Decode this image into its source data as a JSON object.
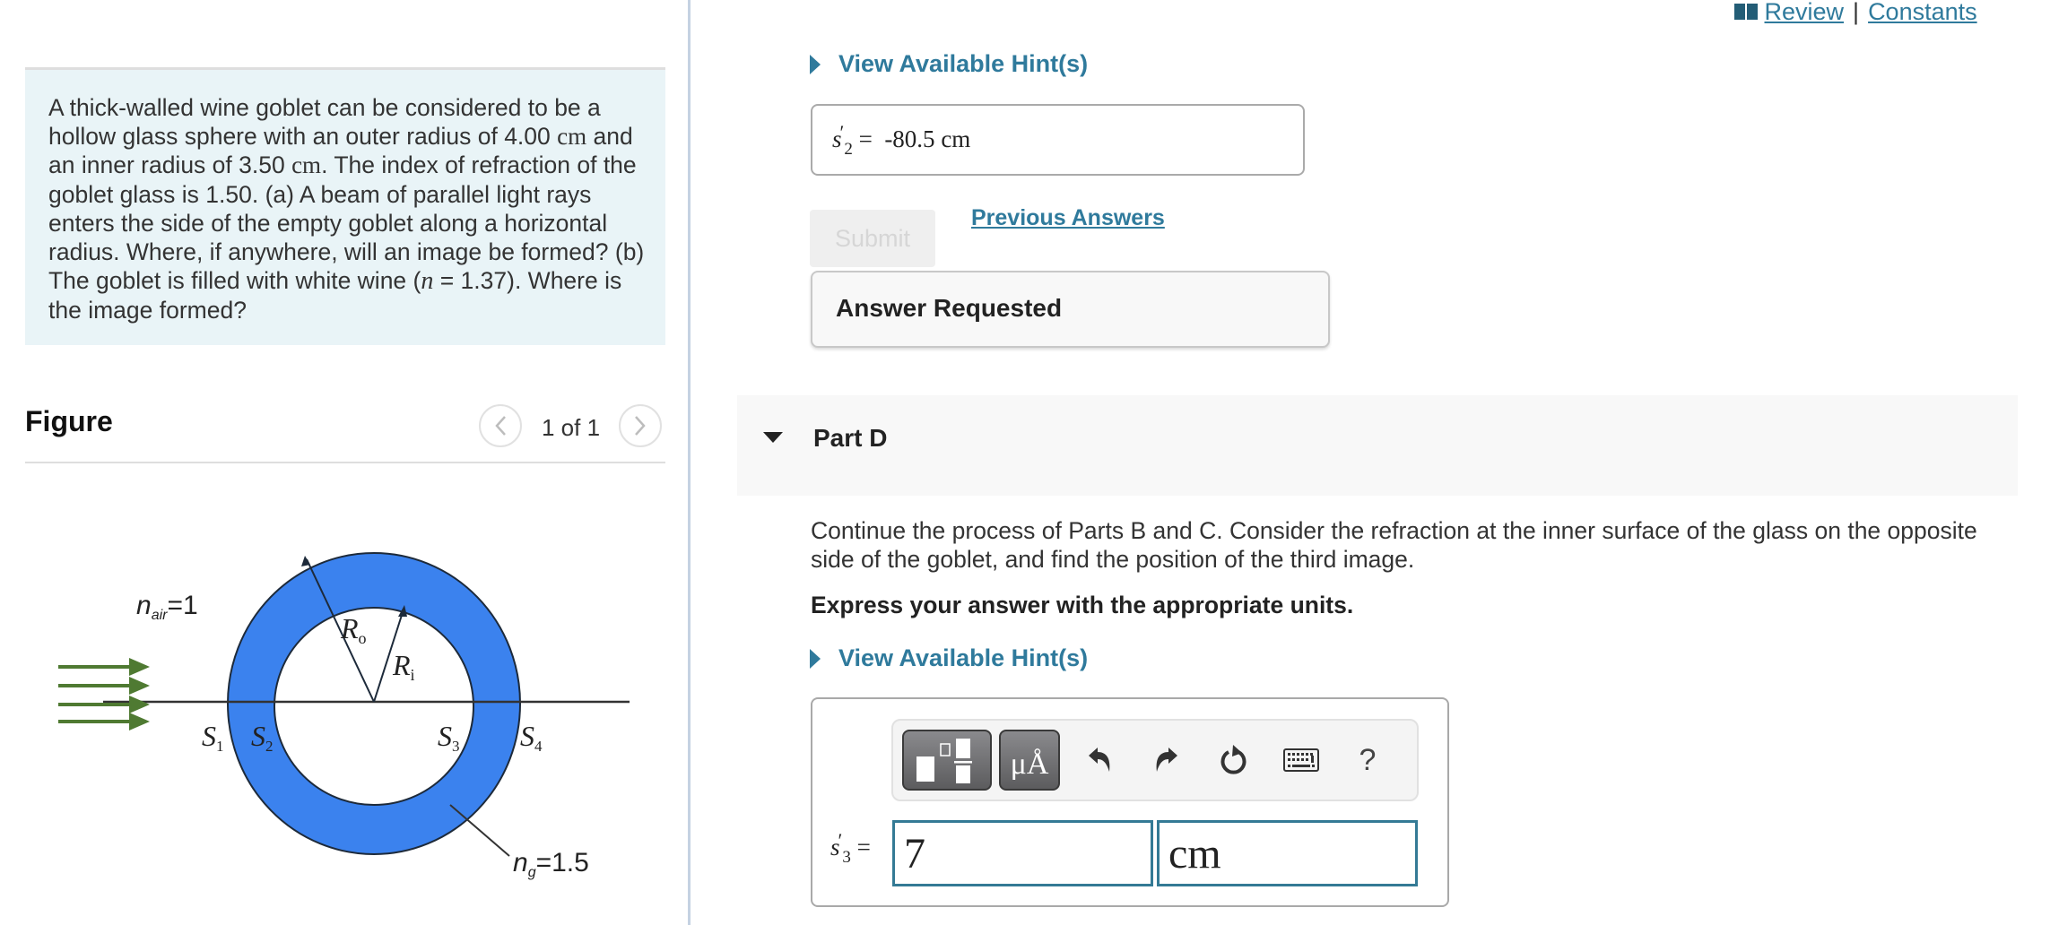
{
  "header_links": {
    "review": "Review",
    "separator": "|",
    "constants": "Constants"
  },
  "problem": {
    "text_parts": [
      "A thick-walled wine goblet can be considered to be a hollow glass sphere with an outer radius of 4.00 ",
      "cm",
      "  and an inner radius of 3.50 ",
      "cm",
      ". The index of refraction of the goblet glass is 1.50. (a) A beam of parallel light rays enters the side of the empty goblet along a horizontal radius. Where, if anywhere, will an image be formed? (b) The goblet is filled with white wine (",
      "n",
      " = 1.37). Where is the image formed?"
    ]
  },
  "figure": {
    "title": "Figure",
    "counter": "1 of 1",
    "prev_icon": "chevron-left-icon",
    "next_icon": "chevron-right-icon",
    "labels": {
      "n_air": "n",
      "n_air_sub": "air",
      "n_air_val": "=1",
      "n_g": "n",
      "n_g_sub": "g",
      "n_g_val": "=1.5",
      "R_o": "R",
      "R_o_sub": "o",
      "R_i": "R",
      "R_i_sub": "i",
      "S1": "S",
      "S1_sub": "1",
      "S2": "S",
      "S2_sub": "2",
      "S3": "S",
      "S3_sub": "3",
      "S4": "S",
      "S4_sub": "4"
    },
    "colors": {
      "glass": "#3b82ee",
      "rays": "#4f7a32"
    }
  },
  "part_c": {
    "hint_label": "View Available Hint(s)",
    "answer": {
      "var": "s",
      "sub": "2",
      "prime": "′",
      "equals": "=",
      "value": "-80.5",
      "unit": "cm"
    },
    "submit_label": "Submit",
    "previous_answers_label": "Previous Answers",
    "status": "Answer Requested"
  },
  "part_d": {
    "title": "Part D",
    "prompt": "Continue the process of Parts B and C. Consider the refraction at the inner surface of the glass on the opposite side of the goblet, and find the position of the third image.",
    "instruction": "Express your answer with the appropriate units.",
    "hint_label": "View Available Hint(s)",
    "toolbar": {
      "templates_icon": "templates-icon",
      "units_label": "μÅ",
      "undo_icon": "undo-icon",
      "redo_icon": "redo-icon",
      "reset_icon": "reset-icon",
      "keyboard_icon": "keyboard-icon",
      "help_label": "?"
    },
    "answer": {
      "var": "s",
      "sub": "3",
      "prime": "′",
      "equals": "=",
      "value": "7",
      "unit": "cm"
    }
  },
  "colors": {
    "accent": "#2f7a9c",
    "problem_bg": "#e9f4f7",
    "field_border": "#347a95"
  }
}
